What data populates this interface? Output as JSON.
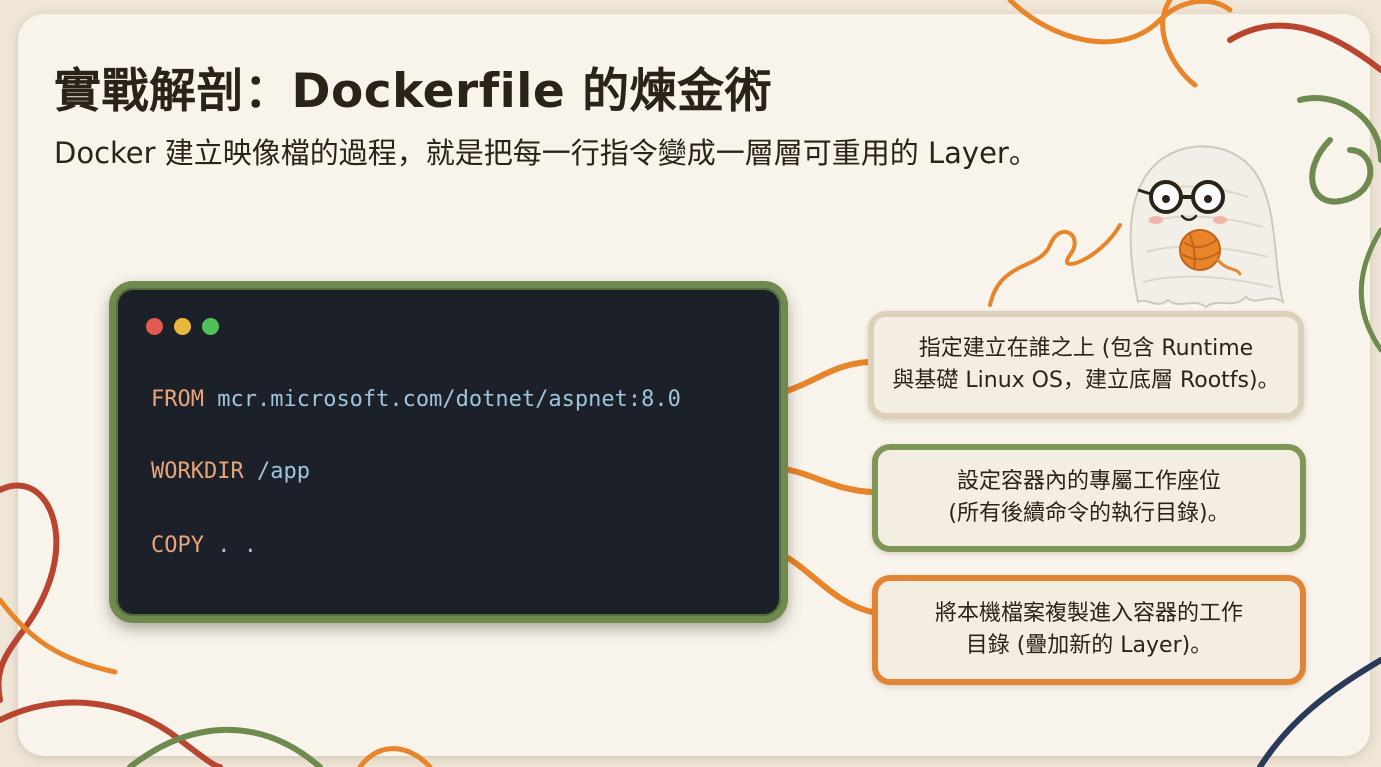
{
  "title": "實戰解剖：Dockerfile 的煉金術",
  "subtitle": "Docker 建立映像檔的過程，就是把每一行指令變成一層層可重用的 Layer。",
  "terminal": {
    "lines": [
      {
        "keyword": "FROM",
        "argument": "mcr.microsoft.com/dotnet/aspnet:8.0"
      },
      {
        "keyword": "WORKDIR",
        "argument": "/app"
      },
      {
        "keyword": "COPY",
        "argument": ". ."
      }
    ]
  },
  "callouts": [
    {
      "text": "指定建立在誰之上 (包含 Runtime\n與基礎 Linux OS，建立底層 Rootfs)。"
    },
    {
      "text": "設定容器內的專屬工作座位\n(所有後續命令的執行目錄)。"
    },
    {
      "text": "將本機檔案複製進入容器的工作\n目錄 (疊加新的 Layer)。"
    }
  ],
  "colors": {
    "background": "#f8f4ec",
    "terminal_bg": "#1c2129",
    "keyword": "#e8a47a",
    "argument": "#9ec3dd",
    "yarn_orange": "#e8842a",
    "yarn_green": "#6f8a4e",
    "yarn_red": "#b8452f"
  },
  "icons": [
    "window-close-dot",
    "window-minimize-dot",
    "window-maximize-dot",
    "yarn-ghost-mascot"
  ]
}
